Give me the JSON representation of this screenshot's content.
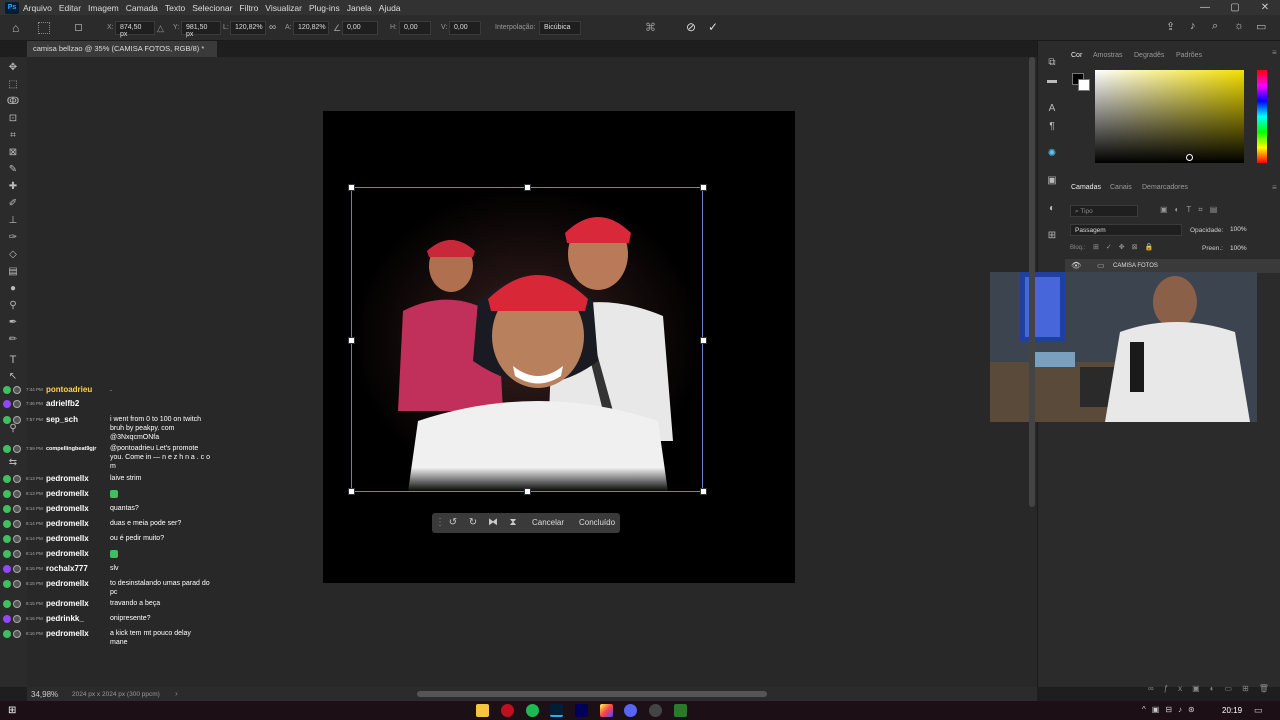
{
  "menubar": {
    "items": [
      "Arquivo",
      "Editar",
      "Imagem",
      "Camada",
      "Texto",
      "Selecionar",
      "Filtro",
      "Visualizar",
      "Plug-ins",
      "Janela",
      "Ajuda"
    ]
  },
  "options": {
    "x_label": "X:",
    "x_value": "874,50 px",
    "y_label": "Y:",
    "y_value": "981,50 px",
    "l_label": "L:",
    "l_value": "120,82%",
    "a_label": "A:",
    "a_value": "120,82%",
    "angle_value": "0,00",
    "h_label": "H:",
    "h_value": "0,00",
    "v_label": "V:",
    "v_value": "0,00",
    "interp_label": "Interpolação:",
    "interp_value": "Bicúbica"
  },
  "document": {
    "tab_title": "camisa bellzao @ 35% (CAMISA FOTOS, RGB/8) *"
  },
  "floatbar": {
    "cancel": "Cancelar",
    "done": "Concluído"
  },
  "panels": {
    "color_tabs": [
      "Cor",
      "Amostras",
      "Degradês",
      "Padrões"
    ],
    "layer_tabs": [
      "Camadas",
      "Canais",
      "Demarcadores"
    ],
    "search_placeholder": "Tipo",
    "blend_mode": "Passagem",
    "opacity_label": "Opacidade:",
    "opacity_value": "100%",
    "lock_label": "Bloq.:",
    "fill_label": "Preen.:",
    "fill_value": "100%",
    "layer_name": "CAMISA FOTOS"
  },
  "chat": {
    "rows": [
      {
        "time": "7:44 PM",
        "user": "pontoadrieu",
        "msg": ".",
        "color": "#ffd24d"
      },
      {
        "time": "7:46 PM",
        "user": "adrielfb2",
        "msg": "",
        "color": "#ffffff"
      },
      {
        "time": "7:57 PM",
        "user": "sep_sch",
        "msg": "i went from 0 to 100 on twitch bruh by peakpy. com      @3NxqcmONfa",
        "color": "#ffffff"
      },
      {
        "time": "7:59 PM",
        "user": "compellingbeat9gjr",
        "msg": "@pontoadrieu Let's promote you. Come in — n e z h n a . c o m",
        "color": "#ffffff"
      },
      {
        "time": "8:13 PM",
        "user": "pedromellx",
        "msg": "laive strim",
        "color": "#ffffff"
      },
      {
        "time": "8:13 PM",
        "user": "pedromellx",
        "msg": "",
        "color": "#ffffff"
      },
      {
        "time": "8:14 PM",
        "user": "pedromellx",
        "msg": "quantas?",
        "color": "#ffffff"
      },
      {
        "time": "8:14 PM",
        "user": "pedromellx",
        "msg": "duas e meia pode ser?",
        "color": "#ffffff"
      },
      {
        "time": "8:14 PM",
        "user": "pedromellx",
        "msg": "ou é pedir muito?",
        "color": "#ffffff"
      },
      {
        "time": "8:14 PM",
        "user": "pedromellx",
        "msg": "",
        "color": "#ffffff"
      },
      {
        "time": "8:15 PM",
        "user": "rochalx777",
        "msg": "slv",
        "color": "#ffffff"
      },
      {
        "time": "8:15 PM",
        "user": "pedromellx",
        "msg": "to desinstalando umas parad do pc",
        "color": "#ffffff"
      },
      {
        "time": "8:15 PM",
        "user": "pedromellx",
        "msg": "travando a beça",
        "color": "#ffffff"
      },
      {
        "time": "8:16 PM",
        "user": "pedrinkk_",
        "msg": "onipresente?",
        "color": "#ffffff"
      },
      {
        "time": "8:16 PM",
        "user": "pedromellx",
        "msg": "a kick tem mt pouco delay mane",
        "color": "#ffffff"
      }
    ]
  },
  "status": {
    "zoom": "34,98%",
    "doc_info": "2024 px x 2024 px (300 ppcm)"
  },
  "taskbar": {
    "time": "20:19"
  }
}
